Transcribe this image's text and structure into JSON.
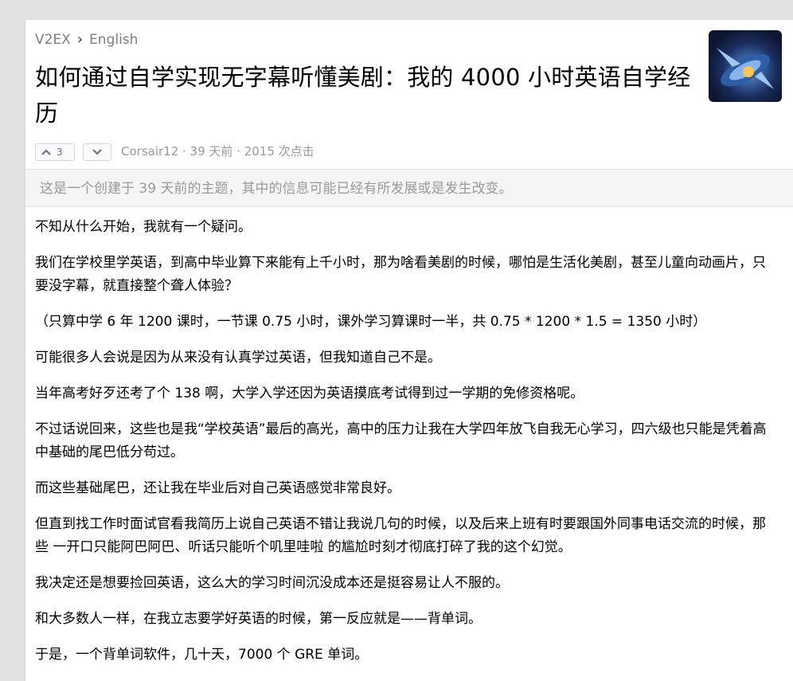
{
  "breadcrumb": {
    "site": "V2EX",
    "separator": "›",
    "node": "English"
  },
  "topic": {
    "title": "如何通过自学实现无字幕听懂美剧：我的 4000 小时英语自学经历",
    "upvotes": "3",
    "author": "Corsair12",
    "meta_rest": " · 39 天前 · 2015 次点击"
  },
  "notice": "这是一个创建于 39 天前的主题，其中的信息可能已经有所发展或是发生改变。",
  "paragraphs": [
    "不知从什么开始，我就有一个疑问。",
    "我们在学校里学英语，到高中毕业算下来能有上千小时，那为啥看美剧的时候，哪怕是生活化美剧，甚至儿童向动画片，只要没字幕，就直接整个聋人体验？",
    "（只算中学 6 年 1200 课时，一节课 0.75 小时，课外学习算课时一半，共 0.75 * 1200 * 1.5 = 1350 小时）",
    "可能很多人会说是因为从来没有认真学过英语，但我知道自己不是。",
    "当年高考好歹还考了个 138 啊，大学入学还因为英语摸底考试得到过一学期的免修资格呢。",
    "不过话说回来，这些也是我“学校英语”最后的高光，高中的压力让我在大学四年放飞自我无心学习，四六级也只能是凭着高中基础的尾巴低分苟过。",
    "而这些基础尾巴，还让我在毕业后对自己英语感觉非常良好。",
    "但直到找工作时面试官看我简历上说自己英语不错让我说几句的时候，以及后来上班有时要跟国外同事电话交流的时候，那些 一开口只能阿巴阿巴、听话只能听个叽里哇啦 的尴尬时刻才彻底打碎了我的这个幻觉。",
    "我决定还是想要捡回英语，这么大的学习时间沉没成本还是挺容易让人不服的。",
    "和大多数人一样，在我立志要学好英语的时候，第一反应就是——背单词。",
    "于是，一个背单词软件，几十天，7000 个 GRE 单词。"
  ]
}
